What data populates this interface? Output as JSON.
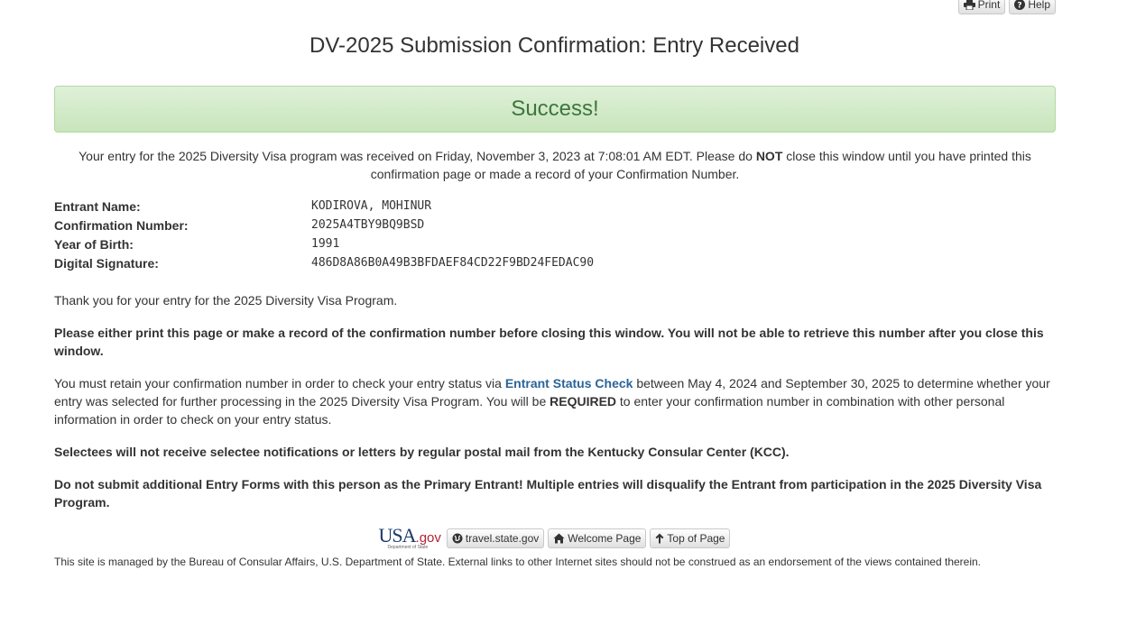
{
  "top_buttons": {
    "print_label": "Print",
    "help_label": "Help"
  },
  "page_title": "DV-2025 Submission Confirmation: Entry Received",
  "alert": {
    "text": "Success!"
  },
  "intro": {
    "part1": "Your entry for the 2025 Diversity Visa program was received on Friday, November 3, 2023 at 7:08:01 AM EDT. Please do ",
    "bold": "NOT",
    "part2": " close this window until you have printed this confirmation page or made a record of your Confirmation Number."
  },
  "details": [
    {
      "label": "Entrant Name:",
      "value": "KODIROVA, MOHINUR"
    },
    {
      "label": "Confirmation Number:",
      "value": "2025A4TBY9BQ9BSD"
    },
    {
      "label": "Year of Birth:",
      "value": "1991"
    },
    {
      "label": "Digital Signature:",
      "value": "486D8A86B0A49B3BFDAEF84CD22F9BD24FEDAC90"
    }
  ],
  "content": {
    "thank_you": "Thank you for your entry for the 2025 Diversity Visa Program.",
    "print_warning": "Please either print this page or make a record of the confirmation number before closing this window. You will not be able to retrieve this number after you close this window.",
    "retain_part1": "You must retain your confirmation number in order to check your entry status via ",
    "retain_link": "Entrant Status Check",
    "retain_part2": " between May 4, 2024 and September 30, 2025 to determine whether your entry was selected for further processing in the 2025 Diversity Visa Program. You will be ",
    "retain_bold": "REQUIRED",
    "retain_part3": " to enter your confirmation number in combination with other personal information in order to check on your entry status.",
    "selectees_notice": "Selectees will not receive selectee notifications or letters by regular postal mail from the Kentucky Consular Center (KCC).",
    "duplicate_warning": "Do not submit additional Entry Forms with this person as the Primary Entrant! Multiple entries will disqualify the Entrant from participation in the 2025 Diversity Visa Program."
  },
  "footer": {
    "logo_main": "USA",
    "logo_gov": ".gov",
    "logo_sub": "Department of State",
    "travel_label": "travel.state.gov",
    "welcome_label": "Welcome Page",
    "top_label": "Top of Page",
    "disclaimer": "This site is managed by the Bureau of Consular Affairs, U.S. Department of State. External links to other Internet sites should not be construed as an endorsement of the views contained therein."
  },
  "colors": {
    "success_bg": "#dff0d8",
    "success_text": "#3c763d",
    "link": "#2a6496"
  }
}
